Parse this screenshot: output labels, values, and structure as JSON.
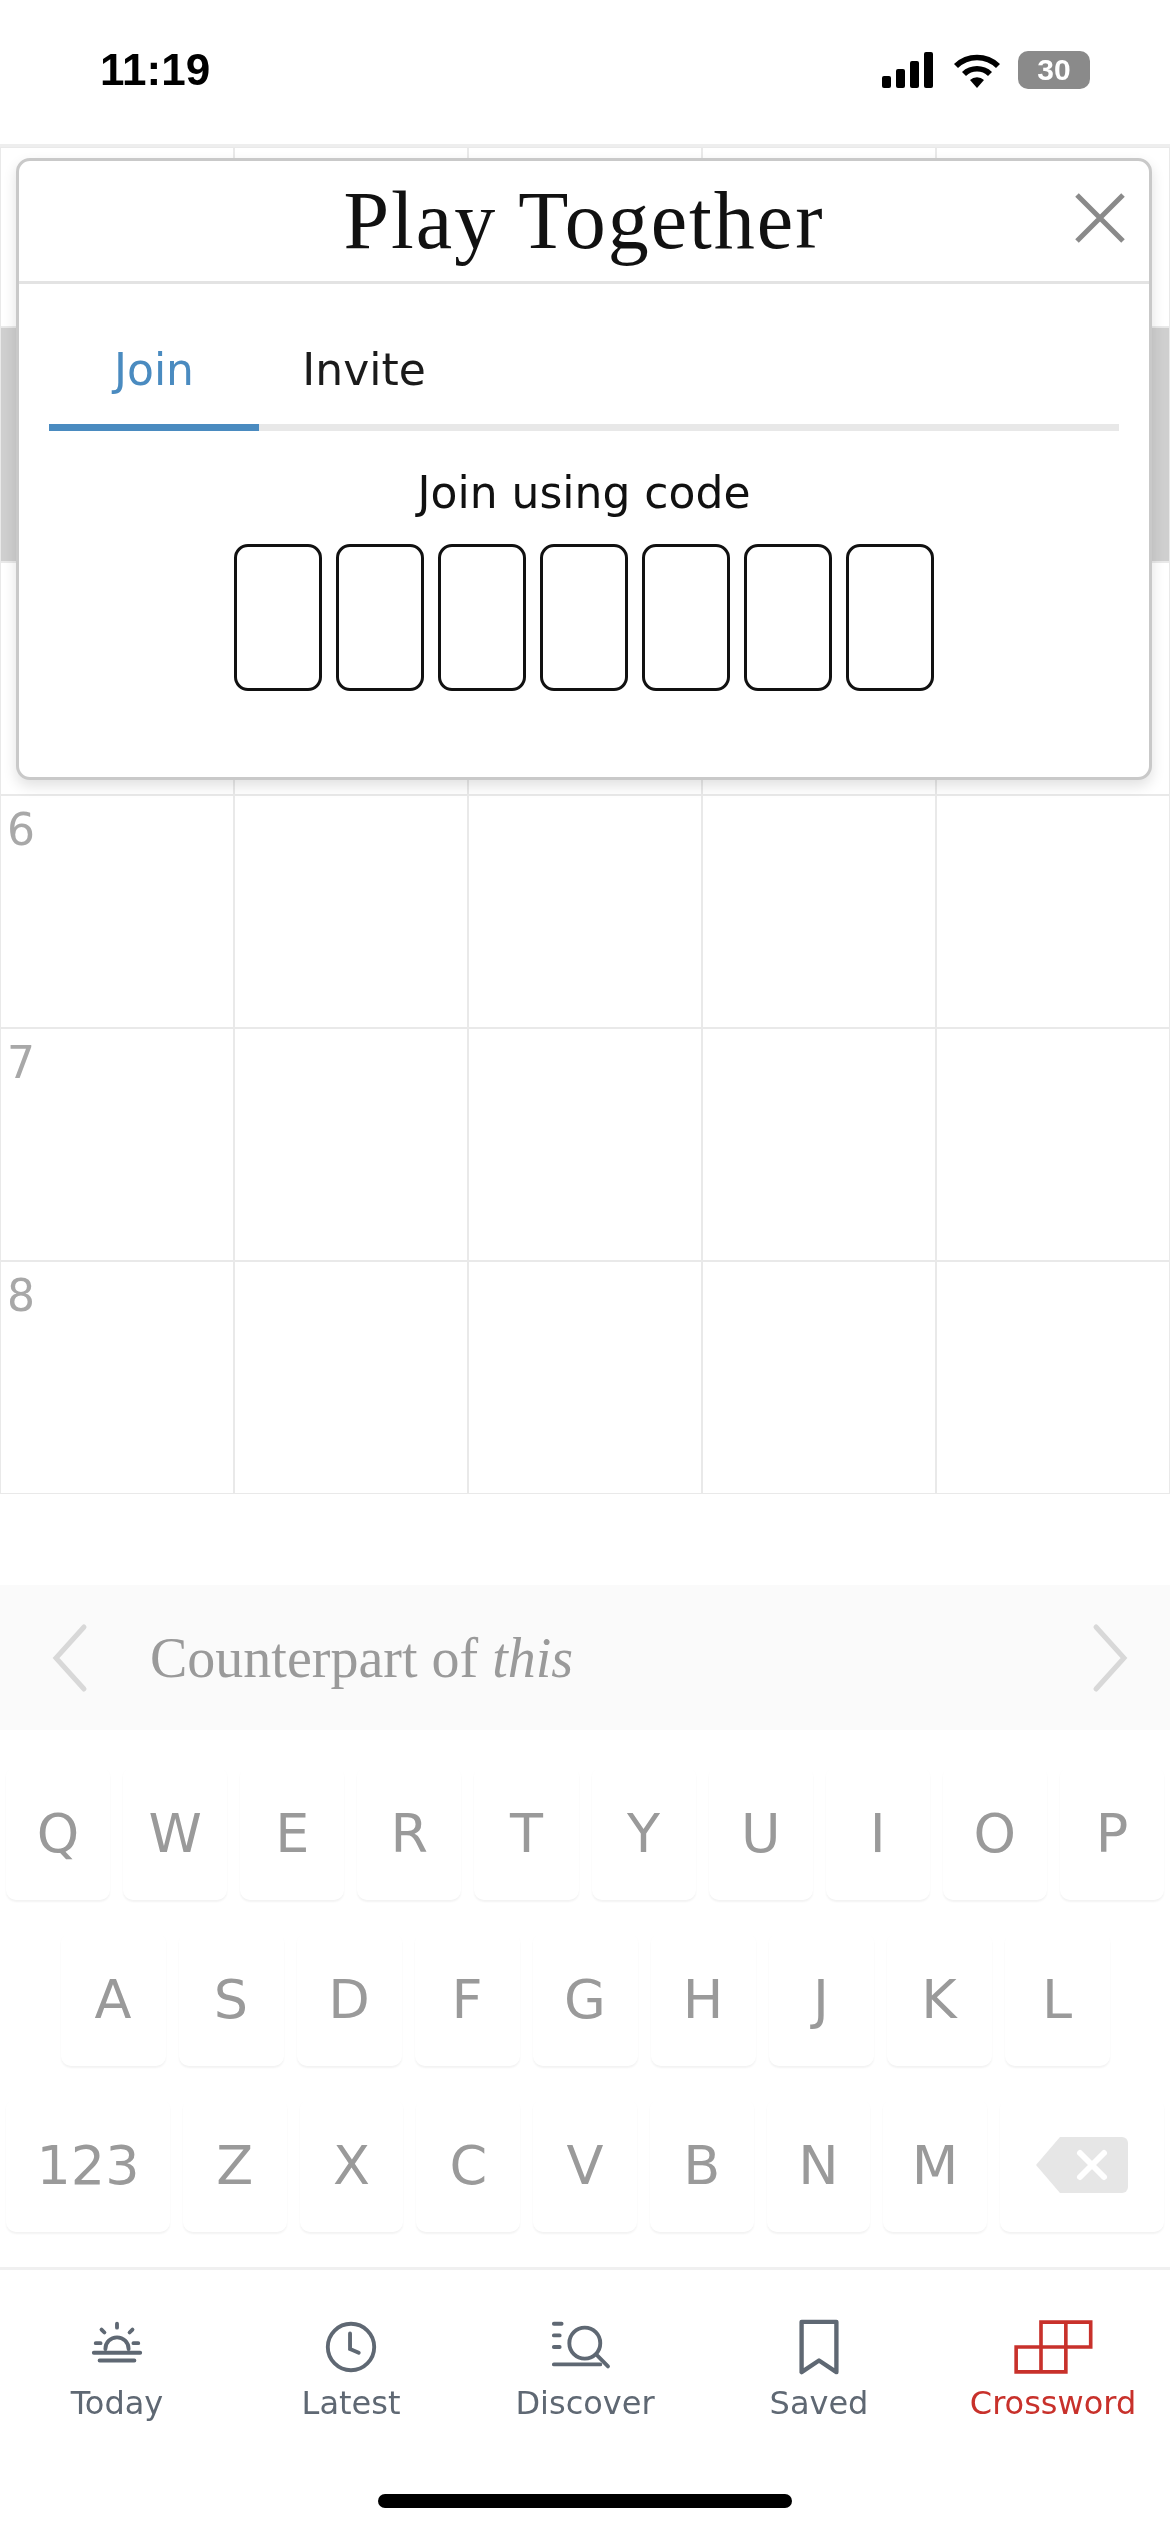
{
  "status_bar": {
    "time": "11:19",
    "battery": "30"
  },
  "grid": {
    "rows": [
      {
        "highlighted": false,
        "cells": [
          {},
          {},
          {},
          {},
          {}
        ]
      },
      {
        "highlighted": true,
        "cells": [
          {},
          {}
        ]
      },
      {
        "highlighted": false,
        "cells": [
          {},
          {},
          {},
          {},
          {}
        ]
      },
      {
        "highlighted": false,
        "cells": [
          {
            "number": "6"
          },
          {},
          {},
          {},
          {}
        ]
      },
      {
        "highlighted": false,
        "cells": [
          {
            "number": "7"
          },
          {},
          {},
          {},
          {}
        ]
      },
      {
        "highlighted": false,
        "cells": [
          {
            "number": "8"
          },
          {},
          {},
          {},
          {}
        ]
      }
    ]
  },
  "dialog": {
    "title": "Play Together",
    "tabs": [
      {
        "label": "Join",
        "selected": true
      },
      {
        "label": "Invite",
        "selected": false
      }
    ],
    "prompt": "Join using code",
    "code_boxes": [
      {
        "filled": false
      },
      {
        "filled": false
      },
      {
        "filled": false
      },
      {
        "filled": false
      },
      {
        "filled": false
      },
      {
        "filled": false
      },
      {
        "filled": false
      }
    ]
  },
  "clue": {
    "text": "Counterpart of *this*"
  },
  "keyboard": {
    "rows": [
      [
        {
          "kind": "letter",
          "label": "Q"
        },
        {
          "kind": "letter",
          "label": "W"
        },
        {
          "kind": "letter",
          "label": "E"
        },
        {
          "kind": "letter",
          "label": "R"
        },
        {
          "kind": "letter",
          "label": "T"
        },
        {
          "kind": "letter",
          "label": "Y"
        },
        {
          "kind": "letter",
          "label": "U"
        },
        {
          "kind": "letter",
          "label": "I"
        },
        {
          "kind": "letter",
          "label": "O"
        },
        {
          "kind": "letter",
          "label": "P"
        }
      ],
      [
        {
          "kind": "letter",
          "label": "A"
        },
        {
          "kind": "letter",
          "label": "S"
        },
        {
          "kind": "letter",
          "label": "D"
        },
        {
          "kind": "letter",
          "label": "F"
        },
        {
          "kind": "letter",
          "label": "G"
        },
        {
          "kind": "letter",
          "label": "H"
        },
        {
          "kind": "letter",
          "label": "J"
        },
        {
          "kind": "letter",
          "label": "K"
        },
        {
          "kind": "letter",
          "label": "L"
        }
      ],
      [
        {
          "kind": "wide",
          "label": "123"
        },
        {
          "kind": "letter",
          "label": "Z"
        },
        {
          "kind": "letter",
          "label": "X"
        },
        {
          "kind": "letter",
          "label": "C"
        },
        {
          "kind": "letter",
          "label": "V"
        },
        {
          "kind": "letter",
          "label": "B"
        },
        {
          "kind": "letter",
          "label": "N"
        },
        {
          "kind": "letter",
          "label": "M"
        },
        {
          "kind": "backspace"
        }
      ]
    ]
  },
  "tab_bar": [
    {
      "label": "Today",
      "selected": false
    },
    {
      "label": "Latest",
      "selected": false
    },
    {
      "label": "Discover",
      "selected": false
    },
    {
      "label": "Saved",
      "selected": false
    },
    {
      "label": "Crossword",
      "selected": true
    }
  ]
}
